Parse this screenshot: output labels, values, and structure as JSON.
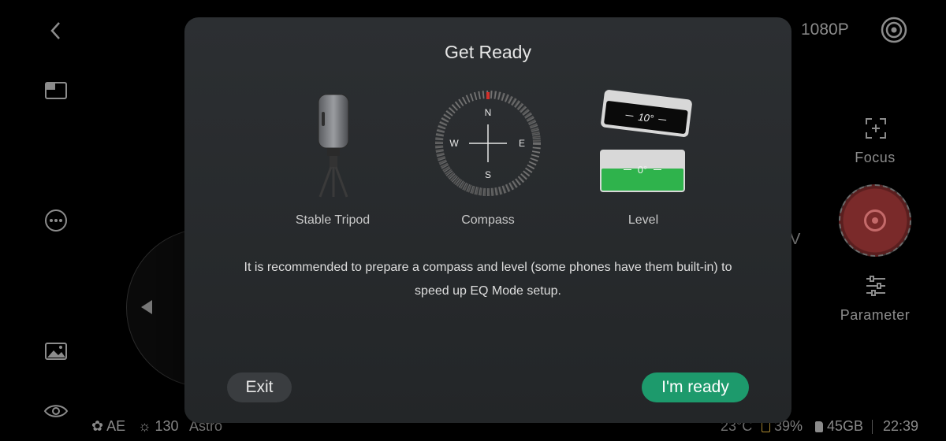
{
  "camera": {
    "resolution": "1080P",
    "focus_label": "Focus",
    "parameter_label": "Parameter",
    "peek_letter": "V"
  },
  "statusbar": {
    "ae": "AE",
    "brightness": "130",
    "mode": "Astro",
    "temperature": "23°C",
    "battery": "39%",
    "storage": "45GB",
    "time": "22:39"
  },
  "dialog": {
    "title": "Get Ready",
    "items": [
      {
        "label": "Stable Tripod"
      },
      {
        "label": "Compass"
      },
      {
        "label": "Level"
      }
    ],
    "compass": {
      "north": "N",
      "south": "S",
      "east": "E",
      "west": "W"
    },
    "level": {
      "tilted": "10°",
      "flat": "0°"
    },
    "description": "It is recommended to prepare a compass and level (some phones have them built-in) to speed up EQ Mode setup.",
    "exit_label": "Exit",
    "ready_label": "I'm ready"
  },
  "colors": {
    "accent": "#1d9a6c",
    "level_green": "#2fb34c",
    "compass_north": "#d0302b",
    "shutter": "#7a2a2a"
  }
}
